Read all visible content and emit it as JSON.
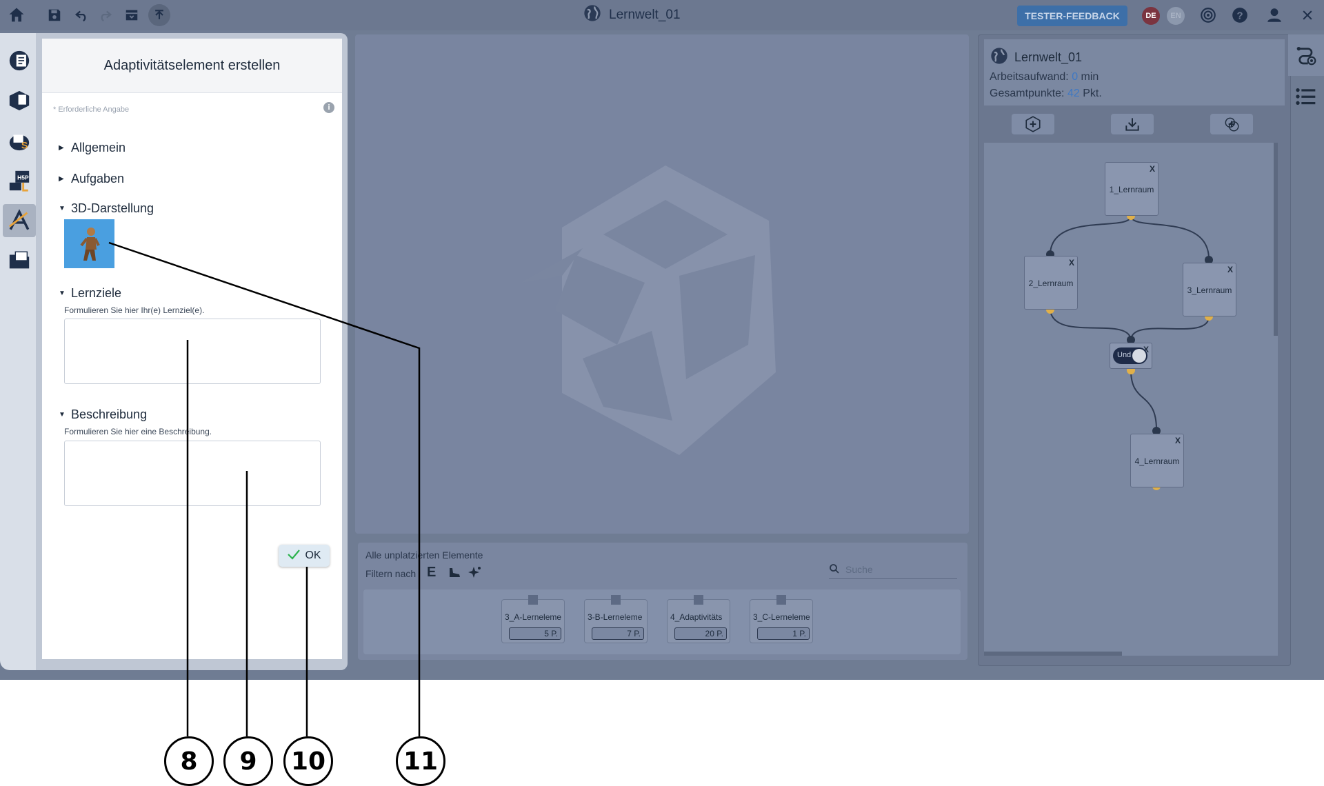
{
  "topbar": {
    "title": "Lernwelt_01",
    "feedback_label": "TESTER-FEEDBACK",
    "lang_de": "DE",
    "lang_en": "EN",
    "icons": [
      "home-icon",
      "save-icon",
      "undo-icon",
      "redo-icon",
      "archive-icon",
      "upload-icon",
      "globe-icon",
      "target-icon",
      "help-icon",
      "user-icon",
      "close-icon"
    ]
  },
  "leftnav": {
    "items": [
      "learning-world-icon",
      "learning-space-icon",
      "learning-elements-icon",
      "h5p-icon",
      "adaptivity-icon",
      "folder-icon"
    ],
    "active_index": 4
  },
  "dialog": {
    "title": "Adaptivitätselement erstellen",
    "required_note": "* Erforderliche Angabe",
    "sections": {
      "allgemein": "Allgemein",
      "aufgaben": "Aufgaben",
      "darstellung": "3D-Darstellung",
      "lernziele": "Lernziele",
      "beschreibung": "Beschreibung"
    },
    "lernziele_hint": "Formulieren Sie hier Ihr(e) Lernziel(e).",
    "beschreibung_hint": "Formulieren Sie hier eine Beschreibung.",
    "ok_label": "OK"
  },
  "unplaced": {
    "title": "Alle unplatzierten Elemente",
    "filter_label": "Filtern nach",
    "filter_letter": "E",
    "search_placeholder": "Suche",
    "elements": [
      {
        "name": "3_A-Lerneleme",
        "points": "5 P."
      },
      {
        "name": "3-B-Lerneleme",
        "points": "7 P."
      },
      {
        "name": "4_Adaptivitäts",
        "points": "20 P."
      },
      {
        "name": "3_C-Lerneleme",
        "points": "1 P."
      }
    ]
  },
  "world_panel": {
    "title": "Lernwelt_01",
    "workload_label": "Arbeitsaufwand:",
    "workload_value": "0",
    "workload_unit": "min",
    "points_label": "Gesamtpunkte:",
    "points_value": "42",
    "points_unit": "Pkt.",
    "nodes": [
      "1_Lernraum",
      "2_Lernraum",
      "3_Lernraum",
      "4_Lernraum"
    ],
    "condition_label": "Und",
    "node_close": "X"
  },
  "annotations": [
    "8",
    "9",
    "10",
    "11"
  ]
}
